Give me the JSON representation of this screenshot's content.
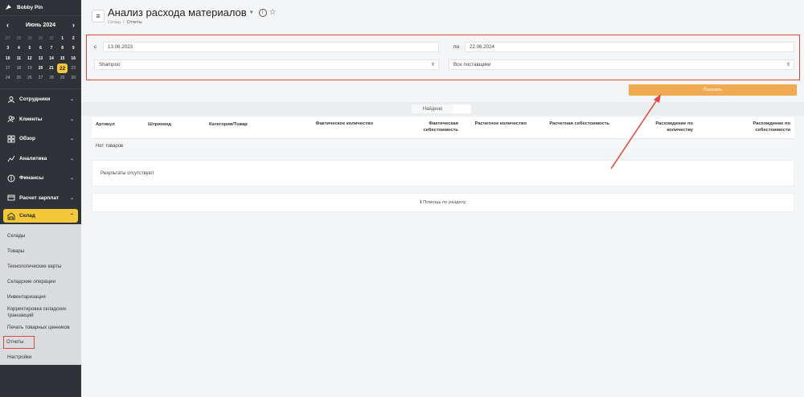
{
  "sidebar": {
    "brand": "Bobby Pin",
    "calendar": {
      "month": "Июнь 2024",
      "prev": "‹",
      "next": "›",
      "weeks": [
        [
          {
            "d": "27",
            "t": "out"
          },
          {
            "d": "28",
            "t": "out"
          },
          {
            "d": "29",
            "t": "out"
          },
          {
            "d": "30",
            "t": "out"
          },
          {
            "d": "31",
            "t": "out"
          },
          {
            "d": "1",
            "t": ""
          },
          {
            "d": "2",
            "t": ""
          }
        ],
        [
          {
            "d": "3",
            "t": ""
          },
          {
            "d": "4",
            "t": ""
          },
          {
            "d": "5",
            "t": ""
          },
          {
            "d": "6",
            "t": ""
          },
          {
            "d": "7",
            "t": ""
          },
          {
            "d": "8",
            "t": ""
          },
          {
            "d": "9",
            "t": ""
          }
        ],
        [
          {
            "d": "10",
            "t": ""
          },
          {
            "d": "11",
            "t": ""
          },
          {
            "d": "12",
            "t": ""
          },
          {
            "d": "13",
            "t": ""
          },
          {
            "d": "14",
            "t": ""
          },
          {
            "d": "15",
            "t": ""
          },
          {
            "d": "16",
            "t": ""
          }
        ],
        [
          {
            "d": "17",
            "t": "past"
          },
          {
            "d": "18",
            "t": "past"
          },
          {
            "d": "19",
            "t": "past"
          },
          {
            "d": "20",
            "t": ""
          },
          {
            "d": "21",
            "t": ""
          },
          {
            "d": "22",
            "t": "today"
          },
          {
            "d": "23",
            "t": "past"
          }
        ],
        [
          {
            "d": "24",
            "t": "past"
          },
          {
            "d": "25",
            "t": "past"
          },
          {
            "d": "26",
            "t": "past"
          },
          {
            "d": "27",
            "t": "past"
          },
          {
            "d": "28",
            "t": "past"
          },
          {
            "d": "29",
            "t": "past"
          },
          {
            "d": "30",
            "t": "past"
          }
        ]
      ]
    },
    "nav": [
      {
        "label": "Сотрудники",
        "icon": "users-icon"
      },
      {
        "label": "Клиенты",
        "icon": "clients-icon"
      },
      {
        "label": "Обзор",
        "icon": "grid-icon"
      },
      {
        "label": "Аналитика",
        "icon": "chart-icon"
      },
      {
        "label": "Финансы",
        "icon": "coin-icon"
      },
      {
        "label": "Расчет зарплат",
        "icon": "salary-icon"
      }
    ],
    "active": {
      "label": "Склад",
      "icon": "warehouse-icon"
    },
    "sub": [
      "Склады",
      "Товары",
      "Технологические карты",
      "Складские операции",
      "Инвентаризация",
      "Корректировка складских транзакций",
      "Печать товарных ценников",
      "Отчеты",
      "Настройки"
    ]
  },
  "header": {
    "title": "Анализ расхода материалов",
    "crumb1": "Склад",
    "crumb_sep": "/",
    "crumb2": "Отчеты"
  },
  "filters": {
    "from_label": "с",
    "from_value": "13.06.2023",
    "to_label": "по",
    "to_value": "22.06.2024",
    "product_value": "Shampoo",
    "supplier_value": "Все поставщики"
  },
  "show_button": "Показать",
  "found_label": "Найдено",
  "table": {
    "columns": [
      "Артикул",
      "Штрихкод",
      "Категория/Товар",
      "Фактическое количество",
      "Фактическая себестоимость",
      "Расчетное количество",
      "Расчетная себестоимость",
      "Расхождение по количеству",
      "Расхождение по себестоимости"
    ],
    "empty_row": "Нет товаров"
  },
  "results_text": "Результаты отсутствуют",
  "help_text": "ℹ Помощь по разделу",
  "colors": {
    "accent": "#f3c93a",
    "button": "#f2ab53",
    "highlight": "#e0473a",
    "sidebar": "#2f3338"
  }
}
